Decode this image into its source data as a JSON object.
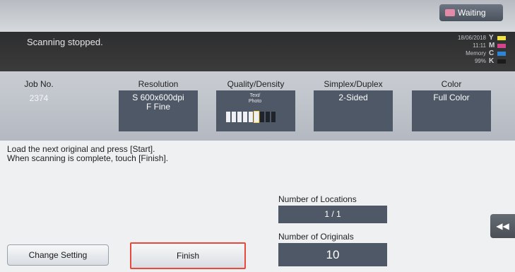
{
  "status": {
    "waiting_label": "Waiting",
    "message": "Scanning stopped."
  },
  "clock": {
    "date": "18/06/2018",
    "time": "11:11",
    "memory_label": "Memory",
    "memory_value": "99%"
  },
  "toner": [
    {
      "letter": "Y",
      "color": "#f1e33d"
    },
    {
      "letter": "M",
      "color": "#d6448b"
    },
    {
      "letter": "C",
      "color": "#2c85d6"
    },
    {
      "letter": "K",
      "color": "#1b1b1b"
    }
  ],
  "settings": {
    "job_no": {
      "label": "Job No.",
      "value": "2374"
    },
    "resolution": {
      "label": "Resolution",
      "value_line1": "S 600x600dpi",
      "value_line2": "F Fine"
    },
    "quality": {
      "label": "Quality/Density",
      "mode": "Text/\nPhoto",
      "density_level": 6,
      "density_steps": 9
    },
    "duplex": {
      "label": "Simplex/Duplex",
      "value": "2-Sided"
    },
    "color": {
      "label": "Color",
      "value": "Full Color"
    }
  },
  "instructions": {
    "line1": "Load the next original and press [Start].",
    "line2": "When scanning is complete, touch [Finish]."
  },
  "counters": {
    "locations_label": "Number of Locations",
    "locations_value": "1 / 1",
    "originals_label": "Number of Originals",
    "originals_value": "10"
  },
  "buttons": {
    "change_setting": "Change Setting",
    "finish": "Finish",
    "nav": "◀◀"
  }
}
